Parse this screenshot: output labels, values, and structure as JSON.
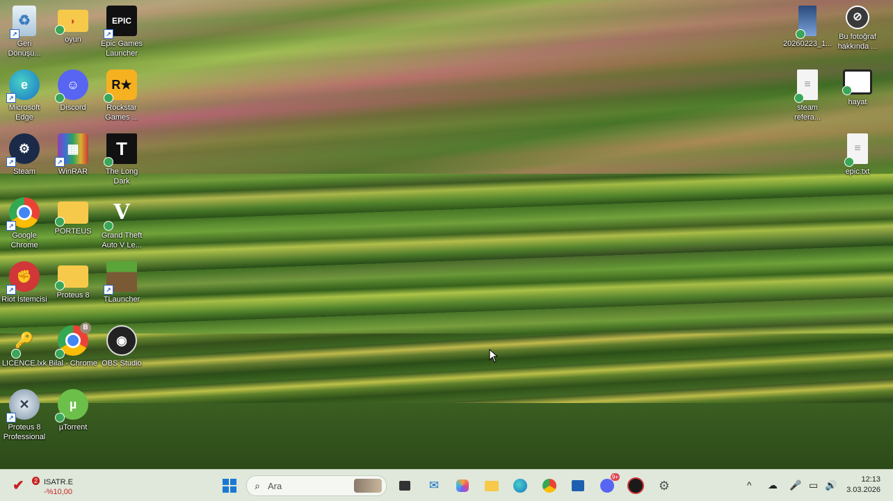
{
  "desktop": {
    "icons": [
      {
        "label": "Geri Dönüşü...",
        "icon": "recycle-bin-icon"
      },
      {
        "label": "oyun",
        "icon": "folder-icon"
      },
      {
        "label": "Epic Games Launcher",
        "icon": "epic-games-icon"
      },
      {
        "label": "Microsoft Edge",
        "icon": "edge-icon"
      },
      {
        "label": "Discord",
        "icon": "discord-icon"
      },
      {
        "label": "Rockstar Games ...",
        "icon": "rockstar-icon"
      },
      {
        "label": "Steam",
        "icon": "steam-icon"
      },
      {
        "label": "WinRAR",
        "icon": "winrar-icon"
      },
      {
        "label": "The Long Dark",
        "icon": "the-long-dark-icon"
      },
      {
        "label": "Google Chrome",
        "icon": "chrome-icon"
      },
      {
        "label": "PORTEUS",
        "icon": "folder-icon"
      },
      {
        "label": "Grand Theft Auto V Le...",
        "icon": "gta-v-icon"
      },
      {
        "label": "Riot İstemcisi",
        "icon": "riot-icon"
      },
      {
        "label": "Proteus 8",
        "icon": "folder-icon"
      },
      {
        "label": "TLauncher",
        "icon": "tlauncher-icon"
      },
      {
        "label": "LICENCE.lxk",
        "icon": "license-file-icon"
      },
      {
        "label": "Bilal - Chrome",
        "icon": "chrome-profile-icon"
      },
      {
        "label": "OBS Studio",
        "icon": "obs-icon"
      },
      {
        "label": "Proteus 8 Professional",
        "icon": "proteus-icon"
      },
      {
        "label": "µTorrent",
        "icon": "utorrent-icon"
      }
    ],
    "right_icons": [
      {
        "label": "20260223_1...",
        "icon": "image-file-icon"
      },
      {
        "label": "Bu fotoğraf hakkında ...",
        "icon": "info-camera-icon"
      },
      {
        "label": "steam referа...",
        "icon": "text-file-icon"
      },
      {
        "label": "hayat",
        "icon": "monitor-icon"
      },
      {
        "label": "epic.txt",
        "icon": "text-file-icon"
      }
    ]
  },
  "taskbar": {
    "widget": {
      "name": "ISATR.E",
      "change": "-%10,00",
      "count": "2"
    },
    "search_placeholder": "Ara",
    "clock_time": "12:13",
    "clock_date": "3.03.2026",
    "discord_badge": "9+"
  },
  "colors": {
    "taskbar_bg": "#dfe8da",
    "accent": "#2b67c5",
    "alert": "#c52424"
  }
}
